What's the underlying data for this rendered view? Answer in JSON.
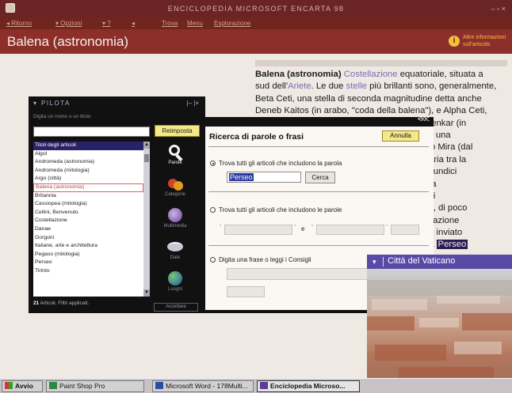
{
  "window": {
    "title": "ENCICLOPEDIA MICROSOFT ENCARTA 98",
    "controls": "– ▫ ×"
  },
  "menubar": {
    "items": [
      "◂ Ritorno",
      "▾ Opzioni",
      "▾ ?",
      "◂",
      "Trova",
      "Menu",
      "Esplorazione"
    ]
  },
  "header": {
    "title": "Balena (astronomia)",
    "info_icon_glyph": "i",
    "info_text": "Altre informazioni sull'articolo"
  },
  "article": {
    "lines": [
      [
        {
          "t": "Balena (astronomia)",
          "s": "b"
        },
        {
          "t": " "
        },
        {
          "t": "Costellazione",
          "s": "lk"
        },
        {
          "t": " equatoriale, situata a"
        }
      ],
      [
        {
          "t": "sud dell'"
        },
        {
          "t": "Ariete",
          "s": "lk"
        },
        {
          "t": ". Le due "
        },
        {
          "t": "stelle",
          "s": "lk"
        },
        {
          "t": " più brillanti sono, generalmente,"
        }
      ],
      [
        {
          "t": "Beta Ceti, una stella di seconda magnitudine detta anche"
        }
      ],
      [
        {
          "t": "Deneb Kaitos (in arabo, \"coda della balena\"), e Alpha Ceti,"
        }
      ],
      [
        {
          "t": "                                                             che Menkar (in"
        }
      ],
      [
        {
          "t": "                                                              rivece una"
        }
      ],
      [
        {
          "t": "                                                              Ceti, o Mira (dal"
        }
      ],
      [
        {
          "t": "                                                              nte varia tra la"
        }
      ],
      [
        {
          "t": "                                                               circa undici"
        }
      ],
      [
        {
          "t": "                                                               conda"
        }
      ],
      [
        {
          "t": "                                                               che si"
        }
      ],
      [
        {
          "t": "                                                               di km, di poco"
        }
      ],
      [
        {
          "t": "                                                               ostellazione"
        }
      ],
      [
        {
          "t": "                                                         "
        },
        {
          "t": "gia greca",
          "s": "lkp"
        },
        {
          "t": " inviato"
        }
      ],
      [
        {
          "t": "                                                         onfitto da "
        },
        {
          "t": "Perseo",
          "s": "hl"
        }
      ]
    ]
  },
  "pilota": {
    "title": "PILOTA",
    "title_arrow": "▾",
    "panel_controls": "|– |×",
    "hint": "Digita un nome o un titolo",
    "search_value": "",
    "reload_button": "Reimposta",
    "list": [
      "Titoli degli articoli",
      "Algol",
      "Andromeda (astronomia)",
      "Andromeda (mitologia)",
      "Argo (città)",
      "Balena (astronomia)",
      "Britannia",
      "Cassiopea (mitologia)",
      "Cellini, Benvenuto",
      "Costellazione",
      "Danae",
      "Gorgoni",
      "Italiane, arte e architettura",
      "Pegaso (mitologia)",
      "Perseo",
      "Tirinto"
    ],
    "footer_count": "21",
    "footer_text": " Articoli. Filtri applicati.",
    "tools": [
      {
        "label": "Parole",
        "icon": "magnifier-icon"
      },
      {
        "label": "Categorie",
        "icon": "fruit-icon"
      },
      {
        "label": "Multimedia",
        "icon": "multimedia-disc-icon"
      },
      {
        "label": "Date",
        "icon": "date-disc-icon"
      },
      {
        "label": "Luoghi",
        "icon": "globe-icon"
      }
    ],
    "accept_button": "Accettare"
  },
  "search_panel": {
    "chevron": "<<<",
    "title": "Ricerca di parole o frasi",
    "cancel_button": "Annulla",
    "option1": "Trova tutti gli articoli che includono la parola",
    "option1_value": "Perseo",
    "search_button": "Cerca",
    "option2": "Trova tutti gli articoli che includono le parole",
    "quote": "\"",
    "and_label": "e",
    "option3": "Digita una frase o leggi i Consigli"
  },
  "city_window": {
    "arrow": "▾",
    "title": "Città del Vaticano"
  },
  "taskbar": {
    "start": "Avvio",
    "items": [
      "Paint Shop Pro",
      "Microsoft Word - 178Multi...",
      "Enciclopedia Microso..."
    ]
  },
  "colors": {
    "titlebar": "#6a2424",
    "header": "#8c2f2b",
    "link": "#7a6bb5",
    "button_yellow": "#f4e98a",
    "city_bar": "#5a4aa6",
    "list_header": "#2a2268"
  }
}
